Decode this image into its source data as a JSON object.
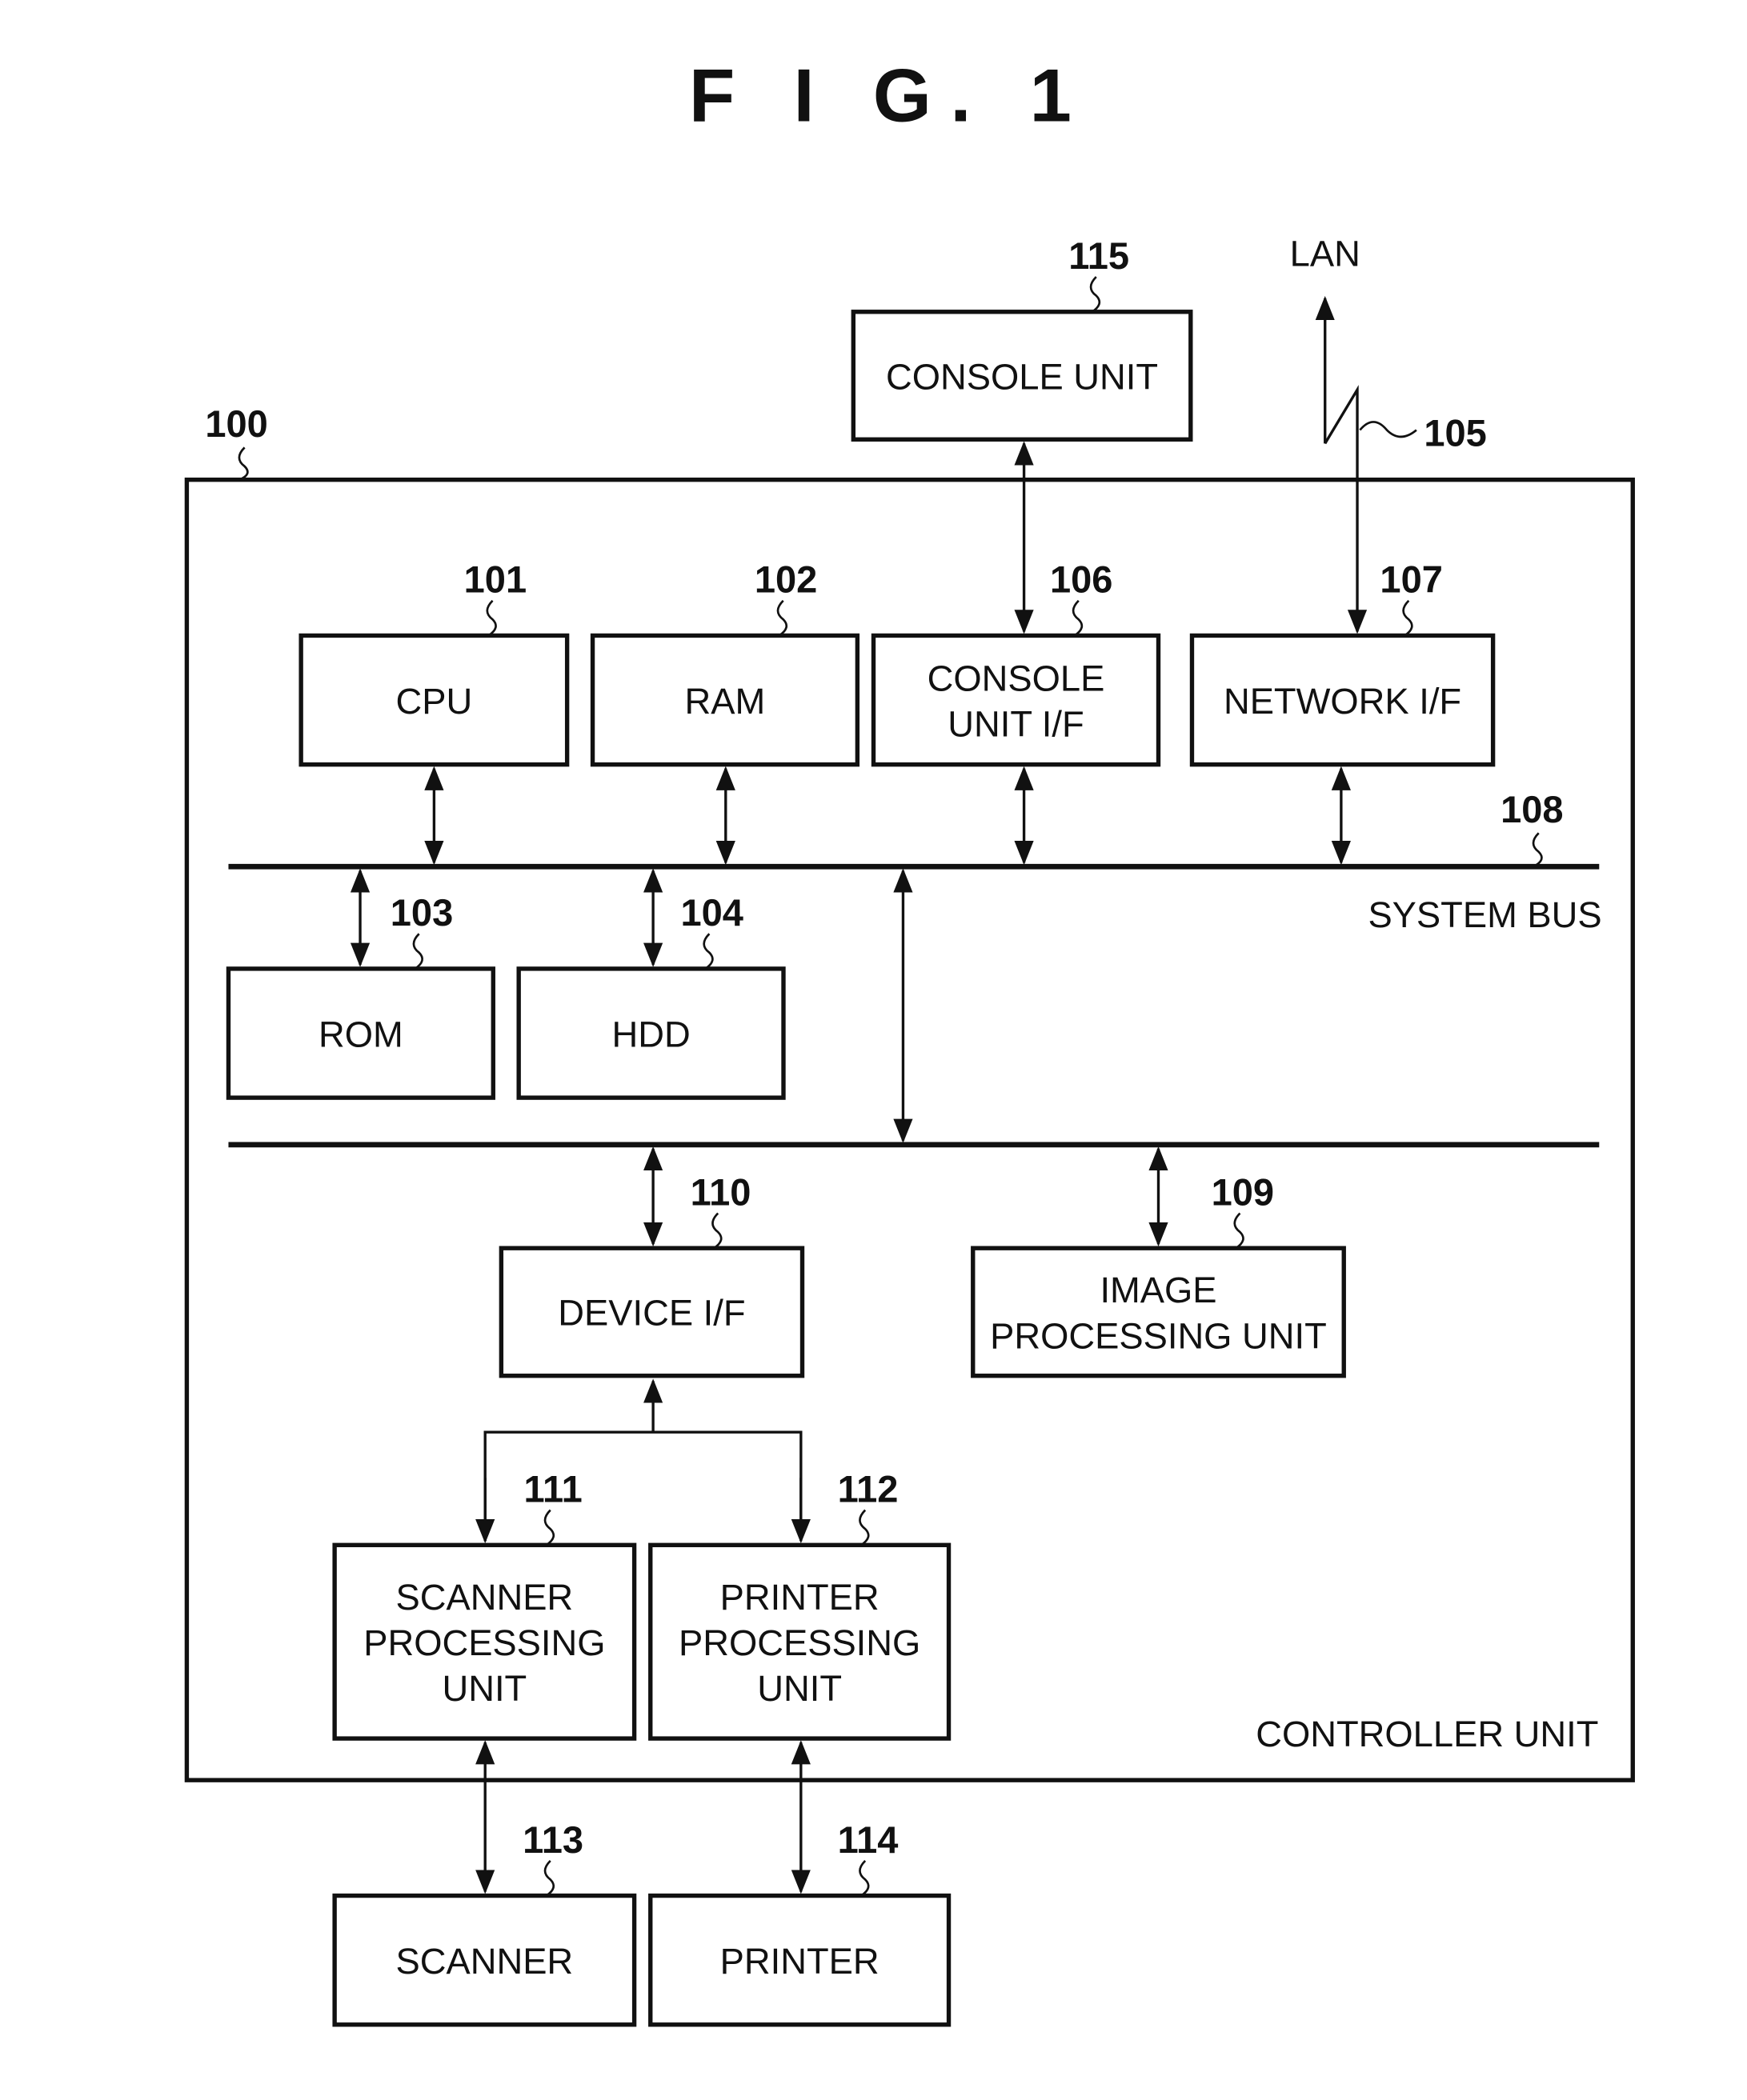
{
  "figure": {
    "title": "F I G.   1"
  },
  "labels": {
    "lan": "LAN",
    "system_bus": "SYSTEM BUS",
    "controller_unit": "CONTROLLER UNIT",
    "ref_100": "100",
    "ref_105": "105",
    "ref_108": "108"
  },
  "blocks": [
    {
      "id": "console-unit",
      "ref": "115",
      "lines": [
        "CONSOLE UNIT"
      ]
    },
    {
      "id": "cpu",
      "ref": "101",
      "lines": [
        "CPU"
      ]
    },
    {
      "id": "ram",
      "ref": "102",
      "lines": [
        "RAM"
      ]
    },
    {
      "id": "console-unit-if",
      "ref": "106",
      "lines": [
        "CONSOLE",
        "UNIT I/F"
      ]
    },
    {
      "id": "network-if",
      "ref": "107",
      "lines": [
        "NETWORK I/F"
      ]
    },
    {
      "id": "rom",
      "ref": "103",
      "lines": [
        "ROM"
      ]
    },
    {
      "id": "hdd",
      "ref": "104",
      "lines": [
        "HDD"
      ]
    },
    {
      "id": "device-if",
      "ref": "110",
      "lines": [
        "DEVICE I/F"
      ]
    },
    {
      "id": "image-processing-unit",
      "ref": "109",
      "lines": [
        "IMAGE",
        "PROCESSING UNIT"
      ]
    },
    {
      "id": "scanner-processing-unit",
      "ref": "111",
      "lines": [
        "SCANNER",
        "PROCESSING",
        "UNIT"
      ]
    },
    {
      "id": "printer-processing-unit",
      "ref": "112",
      "lines": [
        "PRINTER",
        "PROCESSING",
        "UNIT"
      ]
    },
    {
      "id": "scanner",
      "ref": "113",
      "lines": [
        "SCANNER"
      ]
    },
    {
      "id": "printer",
      "ref": "114",
      "lines": [
        "PRINTER"
      ]
    }
  ]
}
